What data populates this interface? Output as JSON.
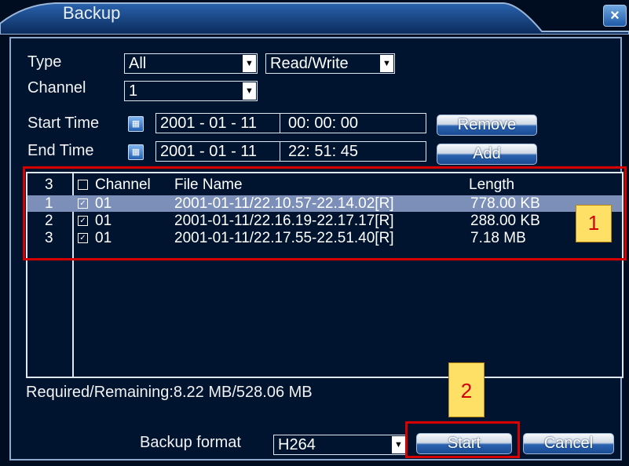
{
  "window": {
    "title": "Backup"
  },
  "form": {
    "type_label": "Type",
    "type_value": "All",
    "mode_value": "Read/Write",
    "channel_label": "Channel",
    "channel_value": "1",
    "start_label": "Start Time",
    "start_date": "2001 - 01 - 11",
    "start_time": "00: 00: 00",
    "end_label": "End Time",
    "end_date": "2001 - 01 - 11",
    "end_time": "22: 51: 45",
    "remove_label": "Remove",
    "add_label": "Add"
  },
  "list": {
    "header": {
      "count": "3",
      "channel": "Channel",
      "file": "File Name",
      "length": "Length"
    },
    "rows": [
      {
        "index": "1",
        "channel": "01",
        "file": "2001-01-11/22.10.57-22.14.02[R]",
        "length": "778.00 KB",
        "selected": true
      },
      {
        "index": "2",
        "channel": "01",
        "file": "2001-01-11/22.16.19-22.17.17[R]",
        "length": "288.00 KB",
        "selected": false
      },
      {
        "index": "3",
        "channel": "01",
        "file": "2001-01-11/22.17.55-22.51.40[R]",
        "length": "7.18 MB",
        "selected": false
      }
    ]
  },
  "status": {
    "required": "Required/Remaining:8.22 MB/528.06 MB"
  },
  "footer": {
    "format_label": "Backup format",
    "format_value": "H264",
    "start_label": "Start",
    "cancel_label": "Cancel"
  },
  "annotations": {
    "tag1": "1",
    "tag2": "2",
    "highlight_color": "#d60000"
  },
  "colors": {
    "background": "#000c1f",
    "selected_row": "#7b8fb8",
    "accent": "#2b63b0"
  }
}
